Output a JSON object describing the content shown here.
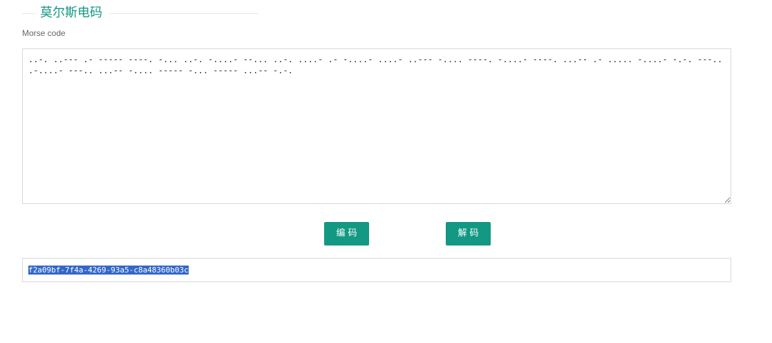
{
  "legend": {
    "title": "莫尔斯电码"
  },
  "input_label": "Morse code",
  "input": {
    "value": "..-. ..--- .- ----- ----. -... ..-. -....- --... ..-. ....- .- -....- ....- ..--- -.... ----. -....- ----. ...-- .- ..... -....- -.-. ---.. .-....- ---.. ...-- -.... ----- -... ----- ...-- -.-."
  },
  "buttons": {
    "encode_label": "编码",
    "decode_label": "解码"
  },
  "output": {
    "value": "f2a09bf-7f4a-4269-93a5-c8a48360b03c"
  },
  "colors": {
    "accent": "#129883",
    "selection": "#3367c9",
    "border": "#d9d9d9"
  }
}
